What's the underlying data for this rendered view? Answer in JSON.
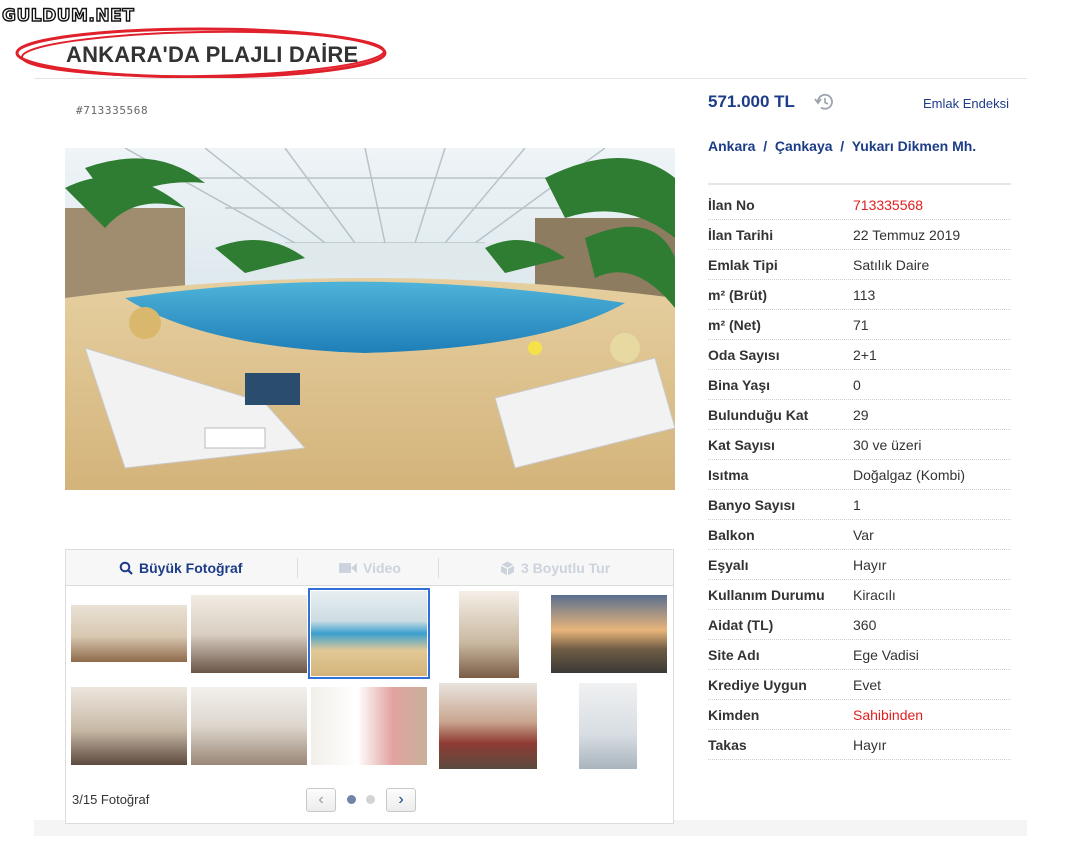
{
  "watermark": "GULDUM.NET",
  "page_title": "ANKARA'DA PLAJLI DAİRE",
  "listing_id": "#713335568",
  "price": "571.000 TL",
  "emlak_link": "Emlak Endeksi",
  "location": {
    "city": "Ankara",
    "district": "Çankaya",
    "neighborhood": "Yukarı Dikmen Mh.",
    "separator": "/"
  },
  "details": [
    {
      "label": "İlan No",
      "value": "713335568",
      "highlight": true
    },
    {
      "label": "İlan Tarihi",
      "value": "22 Temmuz 2019"
    },
    {
      "label": "Emlak Tipi",
      "value": "Satılık Daire"
    },
    {
      "label": "m² (Brüt)",
      "value": "113"
    },
    {
      "label": "m² (Net)",
      "value": "71"
    },
    {
      "label": "Oda Sayısı",
      "value": "2+1"
    },
    {
      "label": "Bina Yaşı",
      "value": "0"
    },
    {
      "label": "Bulunduğu Kat",
      "value": "29"
    },
    {
      "label": "Kat Sayısı",
      "value": "30 ve üzeri"
    },
    {
      "label": "Isıtma",
      "value": "Doğalgaz (Kombi)"
    },
    {
      "label": "Banyo Sayısı",
      "value": "1"
    },
    {
      "label": "Balkon",
      "value": "Var"
    },
    {
      "label": "Eşyalı",
      "value": "Hayır"
    },
    {
      "label": "Kullanım Durumu",
      "value": "Kiracılı"
    },
    {
      "label": "Aidat (TL)",
      "value": "360"
    },
    {
      "label": "Site Adı",
      "value": "Ege Vadisi"
    },
    {
      "label": "Krediye Uygun",
      "value": "Evet"
    },
    {
      "label": "Kimden",
      "value": "Sahibinden",
      "highlight": true
    },
    {
      "label": "Takas",
      "value": "Hayır"
    }
  ],
  "gallery": {
    "tabs": {
      "photo": "Büyük Fotoğraf",
      "video": "Video",
      "tour": "3 Boyutlu Tur"
    },
    "counter": "3/15 Fotoğraf",
    "selected_index": 3,
    "pages": 2,
    "current_page": 1
  },
  "colors": {
    "brand_blue": "#1d3c87",
    "highlight_red": "#e02020",
    "selection_blue": "#2f6fd6",
    "title_circle": "#e0202a"
  },
  "icons": {
    "history": "history-icon",
    "search": "search-icon",
    "video": "video-camera-icon",
    "tour": "cube-icon",
    "prev": "chevron-left-icon",
    "next": "chevron-right-icon"
  }
}
